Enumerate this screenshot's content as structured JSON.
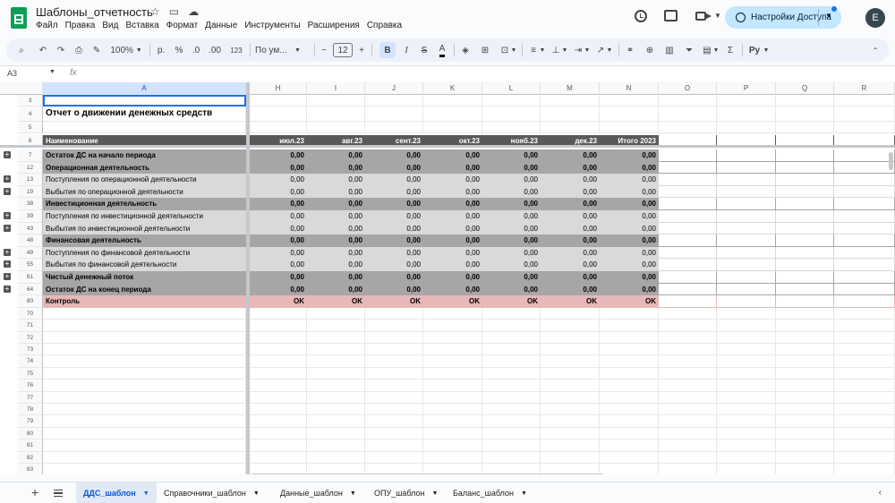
{
  "document": {
    "title": "Шаблоны_отчетность",
    "menu": [
      "Файл",
      "Правка",
      "Вид",
      "Вставка",
      "Формат",
      "Данные",
      "Инструменты",
      "Расширения",
      "Справка"
    ],
    "share_label": "Настройки Доступа",
    "avatar_letter": "E"
  },
  "toolbar": {
    "zoom": "100%",
    "currency": "р.",
    "percent": "%",
    "dec_decrease": ".0",
    "dec_increase": ".00",
    "more_formats": "123",
    "font": "По ум...",
    "font_size": "12",
    "minus": "−",
    "plus": "+",
    "bold": "B",
    "italic": "I",
    "strike": "S",
    "text_color": "A",
    "sigma": "Σ",
    "input_tools": "Pу"
  },
  "formula_bar": {
    "cell_ref": "A3",
    "fx": "fx"
  },
  "columns": [
    "A",
    "H",
    "I",
    "J",
    "K",
    "L",
    "M",
    "N",
    "O",
    "P",
    "Q",
    "R"
  ],
  "sheet": {
    "title_row": {
      "num": "4",
      "text": "Отчет о движении денежных средств"
    },
    "header_row": {
      "num": "6",
      "name": "Наименование",
      "months": [
        "июл.23",
        "авг.23",
        "сент.23",
        "окт.23",
        "нояб.23",
        "дек.23",
        "Итого 2023"
      ]
    },
    "data_rows": [
      {
        "num": "7",
        "style": "dark",
        "plus": true,
        "label": "Остаток ДС на начало периода",
        "values": [
          "0,00",
          "0,00",
          "0,00",
          "0,00",
          "0,00",
          "0,00",
          "0,00"
        ]
      },
      {
        "num": "12",
        "style": "dark",
        "plus": false,
        "label": "Операционная деятельность",
        "values": [
          "0,00",
          "0,00",
          "0,00",
          "0,00",
          "0,00",
          "0,00",
          "0,00"
        ]
      },
      {
        "num": "13",
        "style": "light",
        "plus": true,
        "label": "Поступления по операционной деятельности",
        "values": [
          "0,00",
          "0,00",
          "0,00",
          "0,00",
          "0,00",
          "0,00",
          "0,00"
        ]
      },
      {
        "num": "19",
        "style": "light",
        "plus": true,
        "label": "Выбытия по операционной деятельности",
        "values": [
          "0,00",
          "0,00",
          "0,00",
          "0,00",
          "0,00",
          "0,00",
          "0,00"
        ]
      },
      {
        "num": "38",
        "style": "dark",
        "plus": false,
        "label": "Инвестиционная деятельность",
        "values": [
          "0,00",
          "0,00",
          "0,00",
          "0,00",
          "0,00",
          "0,00",
          "0,00"
        ]
      },
      {
        "num": "39",
        "style": "light",
        "plus": true,
        "label": "Поступления по инвестиционной деятельности",
        "values": [
          "0,00",
          "0,00",
          "0,00",
          "0,00",
          "0,00",
          "0,00",
          "0,00"
        ]
      },
      {
        "num": "43",
        "style": "light",
        "plus": true,
        "label": "Выбытия по инвестиционной деятельности",
        "values": [
          "0,00",
          "0,00",
          "0,00",
          "0,00",
          "0,00",
          "0,00",
          "0,00"
        ]
      },
      {
        "num": "48",
        "style": "dark",
        "plus": false,
        "label": "Финансовая деятельность",
        "values": [
          "0,00",
          "0,00",
          "0,00",
          "0,00",
          "0,00",
          "0,00",
          "0,00"
        ]
      },
      {
        "num": "49",
        "style": "light",
        "plus": true,
        "label": "Поступления по финансовой деятельности",
        "values": [
          "0,00",
          "0,00",
          "0,00",
          "0,00",
          "0,00",
          "0,00",
          "0,00"
        ]
      },
      {
        "num": "55",
        "style": "light",
        "plus": true,
        "label": "Выбытия по финансовой деятельности",
        "values": [
          "0,00",
          "0,00",
          "0,00",
          "0,00",
          "0,00",
          "0,00",
          "0,00"
        ]
      },
      {
        "num": "61",
        "style": "dark",
        "plus": true,
        "label": "Чистый денежный поток",
        "values": [
          "0,00",
          "0,00",
          "0,00",
          "0,00",
          "0,00",
          "0,00",
          "0,00"
        ]
      },
      {
        "num": "64",
        "style": "dark",
        "plus": true,
        "label": "Остаток ДС на конец периода",
        "values": [
          "0,00",
          "0,00",
          "0,00",
          "0,00",
          "0,00",
          "0,00",
          "0,00"
        ]
      },
      {
        "num": "80",
        "style": "control",
        "plus": false,
        "label": "Контроль",
        "values": [
          "OK",
          "OK",
          "OK",
          "OK",
          "OK",
          "OK",
          "OK"
        ]
      }
    ],
    "top_rows": [
      "3",
      "4",
      "5",
      "6"
    ],
    "empty_rows": [
      "70",
      "71",
      "72",
      "73",
      "74",
      "75",
      "76",
      "77",
      "78",
      "79",
      "80",
      "81",
      "82",
      "83"
    ]
  },
  "tabs": [
    {
      "label": "ДДС_шаблон",
      "active": true
    },
    {
      "label": "Справочники_шаблон",
      "active": false
    },
    {
      "label": "Данные_шаблон",
      "active": false
    },
    {
      "label": "ОПУ_шаблон",
      "active": false
    },
    {
      "label": "Баланс_шаблон",
      "active": false
    }
  ],
  "colors": {
    "header_bg": "#595959",
    "dark_row_bg": "#a6a6a6",
    "light_row_bg": "#d9d9d9",
    "control_row_bg": "#e6b8b7",
    "accent": "#1a73e8"
  }
}
